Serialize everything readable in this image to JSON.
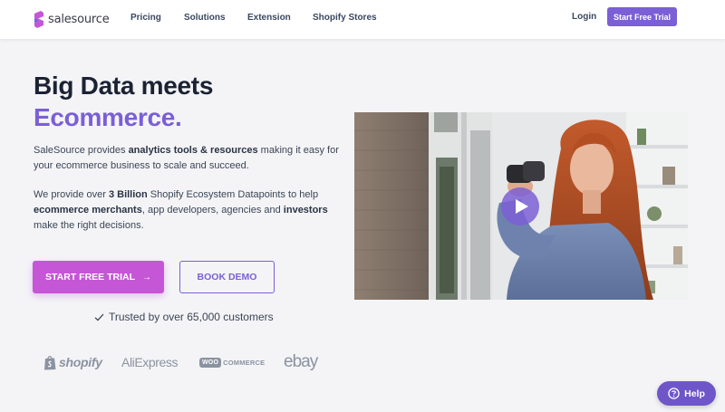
{
  "brand": {
    "name": "salesource",
    "accent_color": "#7b5fd6",
    "cta_color": "#c556d6"
  },
  "nav": {
    "links": [
      "Pricing",
      "Solutions",
      "Extension",
      "Shopify Stores"
    ],
    "login": "Login",
    "trial": "Start Free Trial"
  },
  "hero": {
    "title": "Big Data meets",
    "accent": "Ecommerce.",
    "para1": {
      "a": "SaleSource provides ",
      "b": "analytics tools & resources",
      "c": " making it easy for your ecommerce business to scale and succeed."
    },
    "para2": {
      "a": "We provide over ",
      "b": "3 Billion",
      "c": " Shopify Ecosystem Datapoints to help ",
      "d": "ecommerce merchants",
      "e": ", app developers, agencies and ",
      "f": "investors",
      "g": " make the right decisions."
    }
  },
  "cta": {
    "primary": "START FREE TRIAL",
    "primary_arrow": "→",
    "secondary": "BOOK DEMO",
    "trusted": "Trusted by over 65,000 customers"
  },
  "partners": {
    "shopify": "shopify",
    "aliexpress": "AliExpress",
    "woo_badge": "WOO",
    "woo_rest": "COMMERCE",
    "ebay": "ebay"
  },
  "video": {
    "play_icon": "play-icon"
  },
  "help": {
    "label": "Help",
    "icon": "question-circle-icon"
  }
}
